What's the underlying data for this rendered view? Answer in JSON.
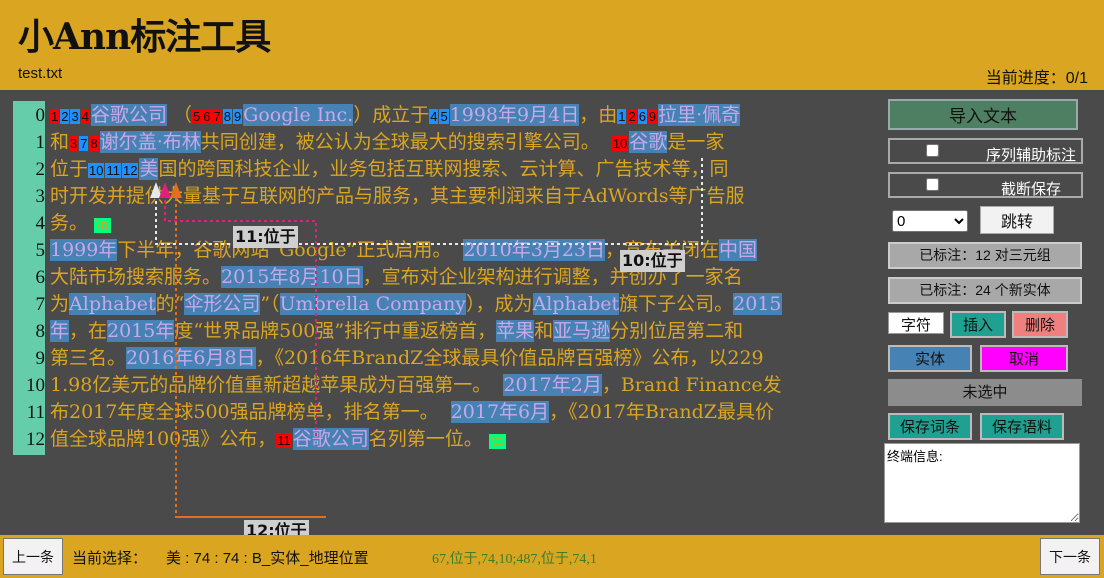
{
  "header": {
    "title": "小Ann标注工具",
    "file_name": "test.txt",
    "progress_label": "当前进度：",
    "progress_value": "0/1"
  },
  "colors": {
    "header_bg": "#daa520",
    "body_bg": "#4a4a4a",
    "entity_bg": "#4682b4",
    "gutter_bg": "#66cdaa",
    "tag_red": "#ff0000",
    "tag_blue": "#1e90ff",
    "newline_bg": "#00ff7f"
  },
  "line_numbers": [
    "0",
    "1",
    "2",
    "3",
    "4",
    "5",
    "6",
    "7",
    "8",
    "9",
    "10",
    "11",
    "12"
  ],
  "lines": [
    [
      {
        "tags": [
          [
            "1",
            "r"
          ],
          [
            "2",
            "b"
          ],
          [
            "3",
            "b"
          ],
          [
            "4",
            "r"
          ]
        ]
      },
      {
        "ent": "谷歌公司"
      },
      {
        "t": " （"
      },
      {
        "tags": [
          [
            "5",
            "r"
          ],
          [
            "6",
            "r"
          ],
          [
            "7",
            "r"
          ],
          [
            "8",
            "b"
          ],
          [
            "9",
            "b"
          ]
        ]
      },
      {
        "ent": "Google Inc."
      },
      {
        "t": "）成立于"
      },
      {
        "tags": [
          [
            "4",
            "b"
          ],
          [
            "5",
            "b"
          ]
        ]
      },
      {
        "ent": "1998年9月4日"
      },
      {
        "t": "，由"
      },
      {
        "tags": [
          [
            "1",
            "b"
          ],
          [
            "2",
            "r"
          ],
          [
            "6",
            "b"
          ],
          [
            "9",
            "r"
          ]
        ]
      },
      {
        "ent": "拉里·佩奇"
      }
    ],
    [
      {
        "t": "和"
      },
      {
        "tags": [
          [
            "3",
            "r"
          ],
          [
            "7",
            "b"
          ],
          [
            "8",
            "r"
          ]
        ]
      },
      {
        "ent": "谢尔盖·布林"
      },
      {
        "t": "共同创建，被公认为全球最大的搜索引擎公司。  "
      },
      {
        "tags": [
          [
            "10",
            "r"
          ]
        ]
      },
      {
        "ent": "谷歌"
      },
      {
        "t": "是一家"
      }
    ],
    [
      {
        "t": "位于"
      },
      {
        "tags": [
          [
            "10",
            "b"
          ],
          [
            "11",
            "b"
          ],
          [
            "12",
            "b"
          ]
        ]
      },
      {
        "ent": "美"
      },
      {
        "t": "国的跨国科技企业，业务包括互联网搜索、云计算、广告技术等，同"
      }
    ],
    [
      {
        "t": "时开发并提供大量基于互联网的产品与服务，其主要利润来自于AdWords等广告服"
      }
    ],
    [
      {
        "t": "务。 "
      },
      {
        "nl": "\\n"
      }
    ],
    [
      {
        "ent": "1999年"
      },
      {
        "t": "下半年，谷歌网站“Google”正式启用。  "
      },
      {
        "ent": "2010年3月23日"
      },
      {
        "t": "，宣布关闭在"
      },
      {
        "ent": "中国"
      }
    ],
    [
      {
        "t": "大陆市场搜索服务。"
      },
      {
        "ent": "2015年8月10日"
      },
      {
        "t": "，宣布对企业架构进行调整，并创办了一家名"
      }
    ],
    [
      {
        "t": "为"
      },
      {
        "ent": "Alphabet"
      },
      {
        "t": "的“"
      },
      {
        "ent": "伞形公司"
      },
      {
        "t": "”（"
      },
      {
        "ent": "Umbrella Company"
      },
      {
        "t": "），成为"
      },
      {
        "ent": "Alphabet"
      },
      {
        "t": "旗下子公司。"
      },
      {
        "ent": "2015"
      }
    ],
    [
      {
        "ent": "年"
      },
      {
        "t": "，在"
      },
      {
        "ent": "2015年"
      },
      {
        "t": "度“世界品牌500强”排行中重返榜首，"
      },
      {
        "ent": "苹果"
      },
      {
        "t": "和"
      },
      {
        "ent": "亚马逊"
      },
      {
        "t": "分别位居第二和"
      }
    ],
    [
      {
        "t": "第三名。"
      },
      {
        "ent": "2016年6月8日"
      },
      {
        "t": "，《2016年BrandZ全球最具价值品牌百强榜》公布，以229"
      }
    ],
    [
      {
        "t": "1.98亿美元的品牌价值重新超越苹果成为百强第一。  "
      },
      {
        "ent": "2017年2月"
      },
      {
        "t": "，Brand Finance发"
      }
    ],
    [
      {
        "t": "布2017年度全球500强品牌榜单，排名第一。  "
      },
      {
        "ent": "2017年6月"
      },
      {
        "t": "，《2017年BrandZ最具价"
      }
    ],
    [
      {
        "t": "值全球品牌100强》公布，"
      },
      {
        "tags": [
          [
            "11",
            "r"
          ]
        ]
      },
      {
        "ent": "谷歌公司"
      },
      {
        "t": "名列第一位。 "
      },
      {
        "nl": "\\n"
      }
    ]
  ],
  "relation_labels": {
    "r10": "10:位于",
    "r11": "11:位于",
    "r12": "12:位于"
  },
  "sidebar": {
    "import_label": "导入文本",
    "seq_assist_label": "序列辅助标注",
    "trunc_save_label": "截断保存",
    "jump_select_value": "0",
    "jump_label": "跳转",
    "triples_label": "已标注：12 对三元组",
    "entities_label": "已标注：24 个新实体",
    "char_label": "字符",
    "insert_label": "插入",
    "delete_label": "删除",
    "entity_label": "实体",
    "cancel_label": "取消",
    "unselected_label": "未选中",
    "save_terms_label": "保存词条",
    "save_corpus_label": "保存语料",
    "terminal_text": "终端信息:"
  },
  "footer": {
    "prev_label": "上一条",
    "next_label": "下一条",
    "selection_label": "当前选择：",
    "selection_value": "美 : 74 : 74 : B_实体_地理位置",
    "status_text": "67,位于,74,10;487,位于,74,1"
  }
}
